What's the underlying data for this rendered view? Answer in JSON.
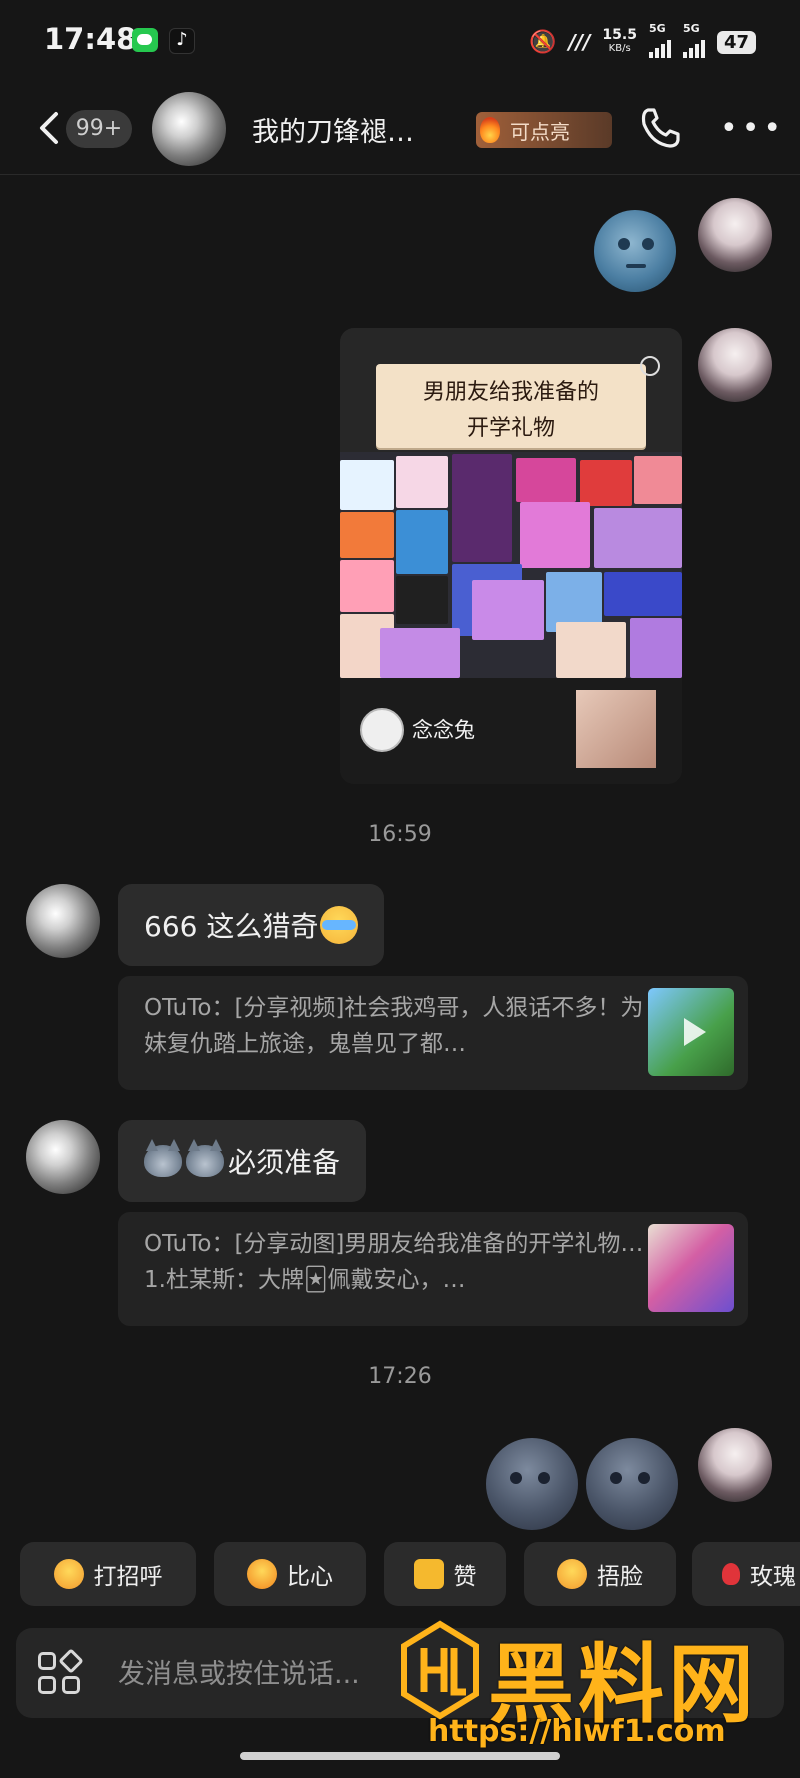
{
  "status_bar": {
    "time": "17:48",
    "network_speed": "15.5",
    "network_unit": "KB/s",
    "signal1_label": "5G",
    "signal2_label": "5G",
    "battery": "47"
  },
  "header": {
    "unread_count": "99+",
    "title": "我的刀锋褪…",
    "spark_label": "可点亮"
  },
  "shared_video": {
    "banner_line1": "男朋友给我准备的",
    "banner_line2": "开学礼物",
    "author": "念念兔"
  },
  "timestamps": [
    "16:59",
    "17:26"
  ],
  "messages": [
    {
      "text": "666 这么猎奇",
      "quote": "OTuTo：[分享视频]社会我鸡哥，人狠话不多！为妹复仇踏上旅途，鬼兽见了都…"
    },
    {
      "text": "必须准备",
      "quote": "OTuTo：[分享动图]男朋友给我准备的开学礼物…1.杜某斯：大牌🃏佩戴安心，…"
    }
  ],
  "quick_replies": [
    {
      "label": "打招呼",
      "icon": "hug-emoji-icon"
    },
    {
      "label": "比心",
      "icon": "heart-hands-icon"
    },
    {
      "label": "赞",
      "icon": "thumbs-up-icon"
    },
    {
      "label": "捂脸",
      "icon": "facepalm-icon"
    },
    {
      "label": "玫瑰",
      "icon": "rose-icon"
    }
  ],
  "input": {
    "placeholder": "发消息或按住说话..."
  },
  "watermark": {
    "text": "黑料网",
    "url": "https://hlwf1.com"
  },
  "colors": {
    "background": "#161616",
    "bubble": "#2c2c2c",
    "watermark": "#ffb31a"
  }
}
